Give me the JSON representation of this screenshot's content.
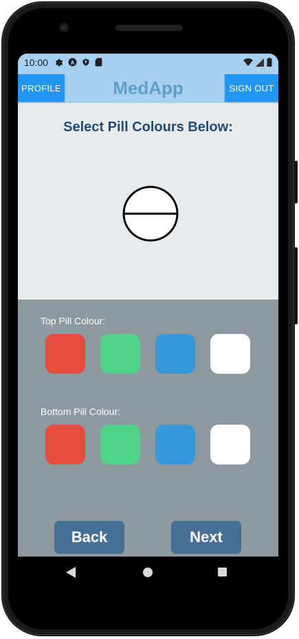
{
  "status_bar": {
    "time": "10:00",
    "left_icons": [
      "gear-icon",
      "app-a-icon",
      "shield-icon",
      "sd-card-icon"
    ],
    "right_icons": [
      "wifi-icon",
      "signal-icon",
      "battery-icon"
    ]
  },
  "header": {
    "profile_label": "PROFILE",
    "title": "MedApp",
    "signout_label": "SIGN OUT"
  },
  "main": {
    "heading": "Select Pill Colours Below:",
    "pill_preview": {
      "top_color": "#ffffff",
      "bottom_color": "#ffffff",
      "outline_color": "#000000"
    }
  },
  "colour_picker": {
    "top_label": "Top Pill Colour:",
    "bottom_label": "Bottom Pill Colour:",
    "swatches": [
      {
        "name": "red",
        "color": "#e74c3c"
      },
      {
        "name": "green",
        "color": "#50d28b"
      },
      {
        "name": "blue",
        "color": "#3498db"
      },
      {
        "name": "white",
        "color": "#ffffff"
      }
    ]
  },
  "footer_buttons": {
    "back_label": "Back",
    "next_label": "Next"
  },
  "android_nav": {
    "icons": [
      "back-triangle-icon",
      "home-circle-icon",
      "recents-square-icon"
    ]
  },
  "colors": {
    "header_bg": "#a8d0f0",
    "button_blue": "#2196f3",
    "title_color": "#5c9fcc",
    "heading_color": "#244a74",
    "top_bg": "#e6ebee",
    "bottom_bg": "#8e999f",
    "nav_button_bg": "#466f96"
  }
}
